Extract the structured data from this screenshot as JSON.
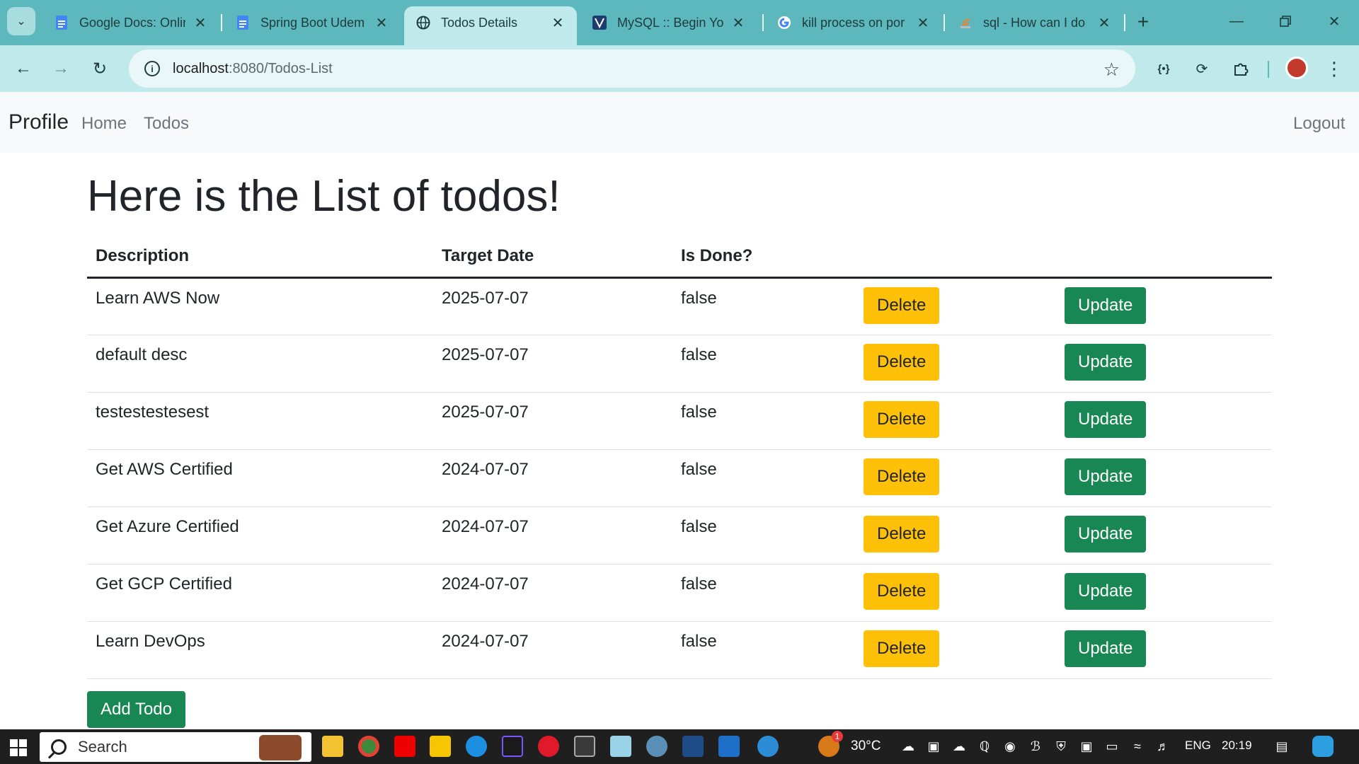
{
  "browser": {
    "tabs": [
      {
        "title": "Google Docs: Onlin",
        "favicon": "docs-icon",
        "active": false
      },
      {
        "title": "Spring Boot Udem",
        "favicon": "docs-icon",
        "active": false
      },
      {
        "title": "Todos Details",
        "favicon": "globe-icon",
        "active": true
      },
      {
        "title": "MySQL :: Begin You",
        "favicon": "mysql-icon",
        "active": false
      },
      {
        "title": "kill process on por",
        "favicon": "google-icon",
        "active": false
      },
      {
        "title": "sql - How can I do",
        "favicon": "stackoverflow-icon",
        "active": false
      }
    ],
    "url_host": "localhost",
    "url_path": ":8080/Todos-List"
  },
  "app_nav": {
    "brand": "Profile",
    "links": [
      "Home",
      "Todos"
    ],
    "logout": "Logout"
  },
  "page": {
    "heading": "Here is the List of todos!",
    "columns": [
      "Description",
      "Target Date",
      "Is Done?"
    ],
    "rows": [
      {
        "description": "Learn AWS Now",
        "target_date": "2025-07-07",
        "done": "false"
      },
      {
        "description": "default desc",
        "target_date": "2025-07-07",
        "done": "false"
      },
      {
        "description": "testestestesest",
        "target_date": "2025-07-07",
        "done": "false"
      },
      {
        "description": "Get AWS Certified",
        "target_date": "2024-07-07",
        "done": "false"
      },
      {
        "description": "Get Azure Certified",
        "target_date": "2024-07-07",
        "done": "false"
      },
      {
        "description": "Get GCP Certified",
        "target_date": "2024-07-07",
        "done": "false"
      },
      {
        "description": "Learn DevOps",
        "target_date": "2024-07-07",
        "done": "false"
      }
    ],
    "delete_label": "Delete",
    "update_label": "Update",
    "add_label": "Add Todo"
  },
  "taskbar": {
    "search_label": "Search",
    "temperature": "30°C",
    "language": "ENG",
    "time": "20:19",
    "weather_badge": "1"
  },
  "colors": {
    "delete_button": "#ffc107",
    "update_button": "#198754",
    "tab_strip": "#5db8be",
    "toolbar": "#bfe9ea"
  }
}
